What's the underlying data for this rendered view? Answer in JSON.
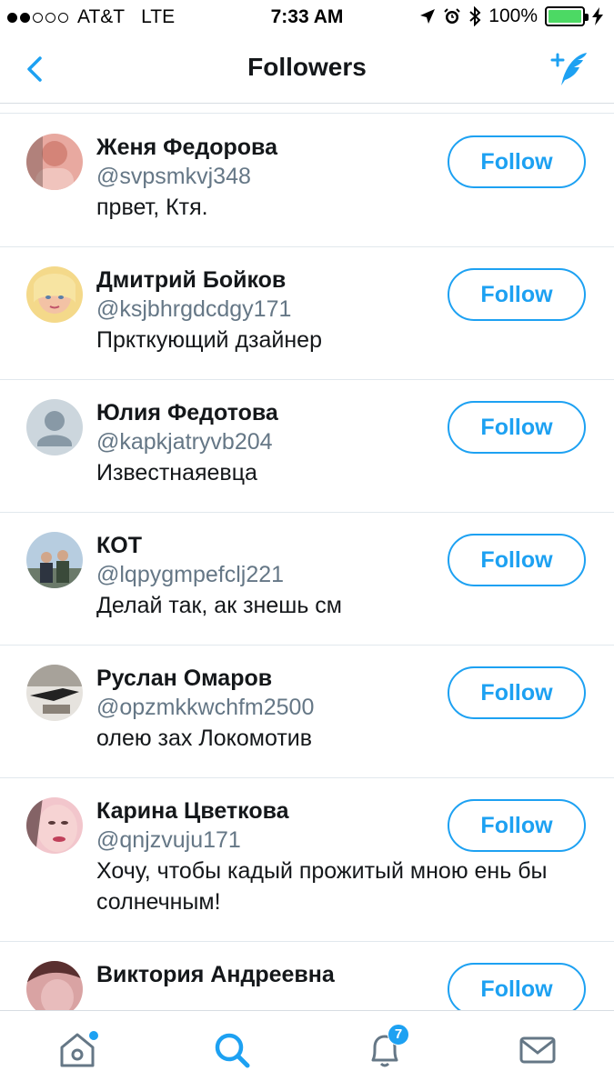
{
  "status_bar": {
    "carrier": "AT&T",
    "network": "LTE",
    "time": "7:33 AM",
    "battery": "100%",
    "signal_bars_filled": 2,
    "signal_bars_total": 5
  },
  "nav": {
    "title": "Followers",
    "back_icon": "chevron-left-icon",
    "compose_icon": "compose-tweet-icon"
  },
  "colors": {
    "accent": "#1da1f2",
    "secondary_text": "#657786",
    "divider": "#e1e8ed"
  },
  "followers": [
    {
      "name": "Женя Федорова",
      "handle": "@svpsmkvj348",
      "bio": "првет, Ктя.",
      "button": "Follow"
    },
    {
      "name": "Дмитрий Бойков",
      "handle": "@ksjbhrgdcdgy171",
      "bio": "Прктку­ющий дзайнер",
      "button": "Follow"
    },
    {
      "name": "Юлия Федотова",
      "handle": "@kapkjatryvb204",
      "bio": "Известнаяевца",
      "button": "Follow"
    },
    {
      "name": "КОТ",
      "handle": "@lqpygmpefclj221",
      "bio": "Делай так, ак знешь см",
      "button": "Follow"
    },
    {
      "name": "Руслан Омаров",
      "handle": "@opzmkkwchfm2500",
      "bio": "олею зах Локомотив",
      "button": "Follow"
    },
    {
      "name": "Карина Цветкова",
      "handle": "@qnjzvuju171",
      "bio": "Хочу, чтобы кадый прожитый мною ень бы солнечным!",
      "button": "Follow"
    },
    {
      "name": "Виктория Андреевна",
      "handle": "",
      "bio": "",
      "button": "Follow"
    }
  ],
  "tab_bar": {
    "tabs": [
      {
        "icon": "home-icon",
        "active": false,
        "has_dot": true
      },
      {
        "icon": "search-icon",
        "active": true
      },
      {
        "icon": "bell-icon",
        "active": false,
        "badge": "7"
      },
      {
        "icon": "mail-icon",
        "active": false
      }
    ]
  }
}
